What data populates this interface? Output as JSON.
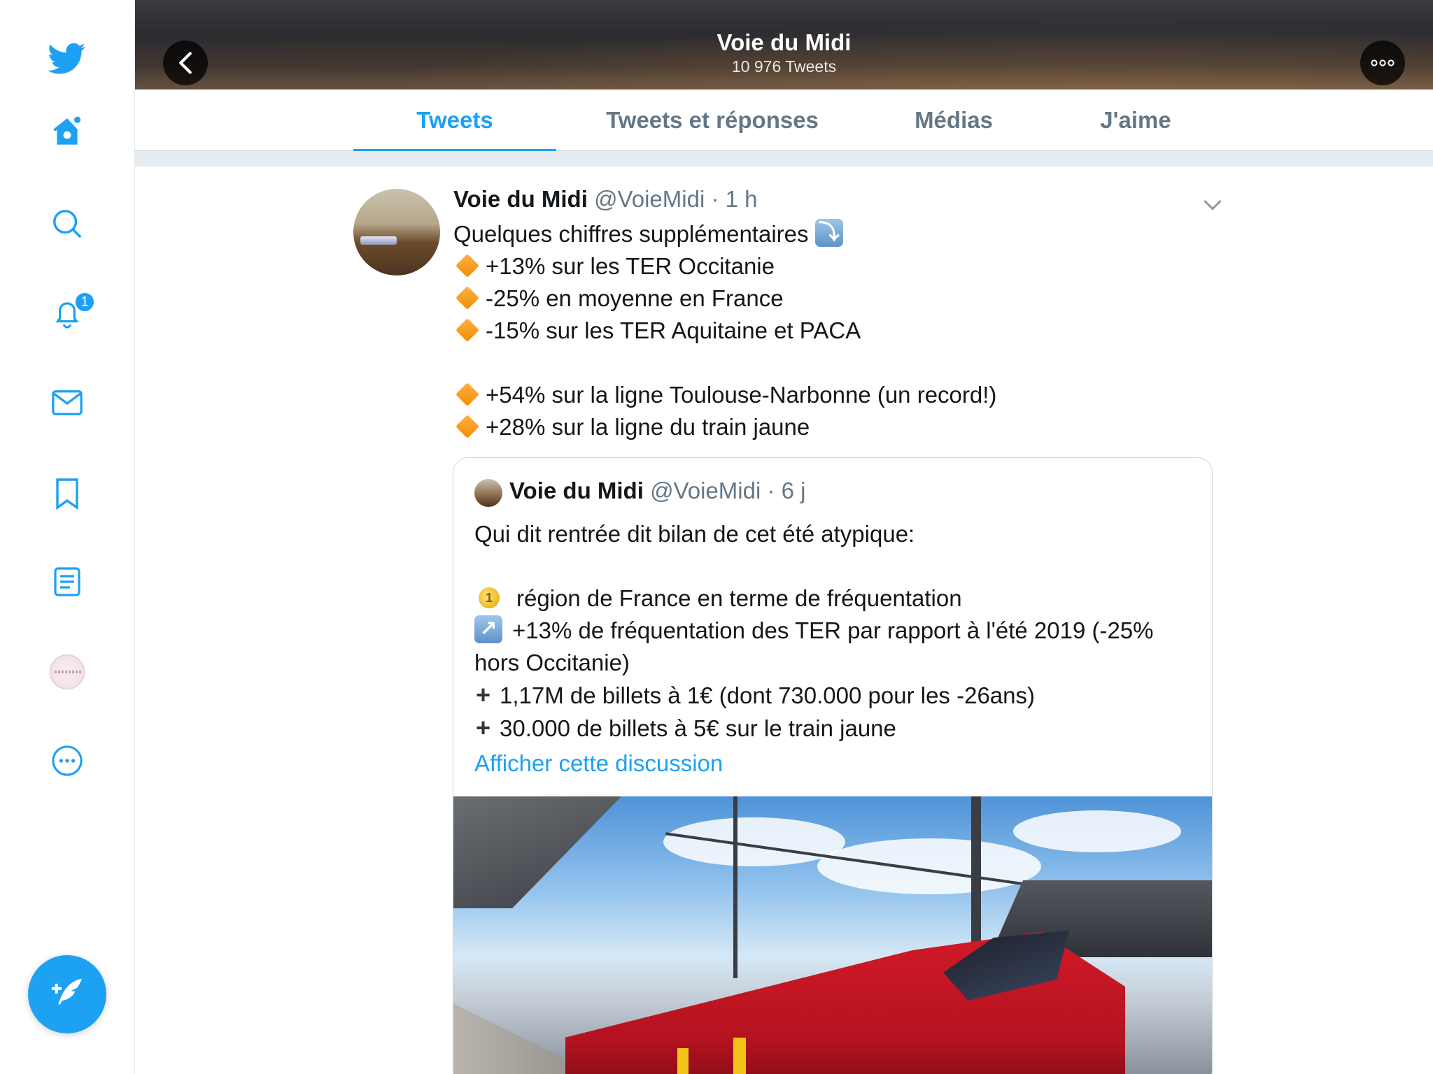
{
  "sidebar": {
    "items": [
      {
        "name": "twitter-logo-icon"
      },
      {
        "name": "home-icon"
      },
      {
        "name": "search-icon"
      },
      {
        "name": "notifications-icon",
        "badge": "1"
      },
      {
        "name": "messages-icon"
      },
      {
        "name": "bookmarks-icon"
      },
      {
        "name": "lists-icon"
      },
      {
        "name": "profile-avatar"
      },
      {
        "name": "more-icon"
      }
    ],
    "compose": {
      "icon": "compose-tweet-icon"
    }
  },
  "header": {
    "title": "Voie du Midi",
    "subtitle": "10 976 Tweets"
  },
  "tabs": [
    {
      "label": "Tweets",
      "active": true
    },
    {
      "label": "Tweets et réponses",
      "active": false
    },
    {
      "label": "Médias",
      "active": false
    },
    {
      "label": "J'aime",
      "active": false
    }
  ],
  "tweet": {
    "name": "Voie du Midi",
    "handle": "@VoieMidi",
    "time": "1 h",
    "lines": {
      "intro": "Quelques chiffres supplémentaires",
      "l1": "+13% sur les TER Occitanie",
      "l2": "-25% en moyenne en France",
      "l3": "-15% sur les TER Aquitaine et PACA",
      "l4": "+54% sur la ligne Toulouse-Narbonne (un record!)",
      "l5": "+28% sur la ligne du train jaune"
    },
    "quote": {
      "name": "Voie du Midi",
      "handle": "@VoieMidi",
      "time": "6 j",
      "intro": "Qui dit rentrée dit bilan de cet été atypique:",
      "q1": "région de France en terme de fréquentation",
      "q2a": "+13% de fréquentation des TER par rapport à l'été 2019 (-25%",
      "q2b": "hors Occitanie)",
      "q3": "1,17M de billets à 1€ (dont 730.000 pour les -26ans)",
      "q4": "30.000 de billets à 5€ sur le train jaune",
      "link": "Afficher cette discussion"
    }
  },
  "colors": {
    "accent": "#1da1f2",
    "secondary_text": "#657786"
  }
}
